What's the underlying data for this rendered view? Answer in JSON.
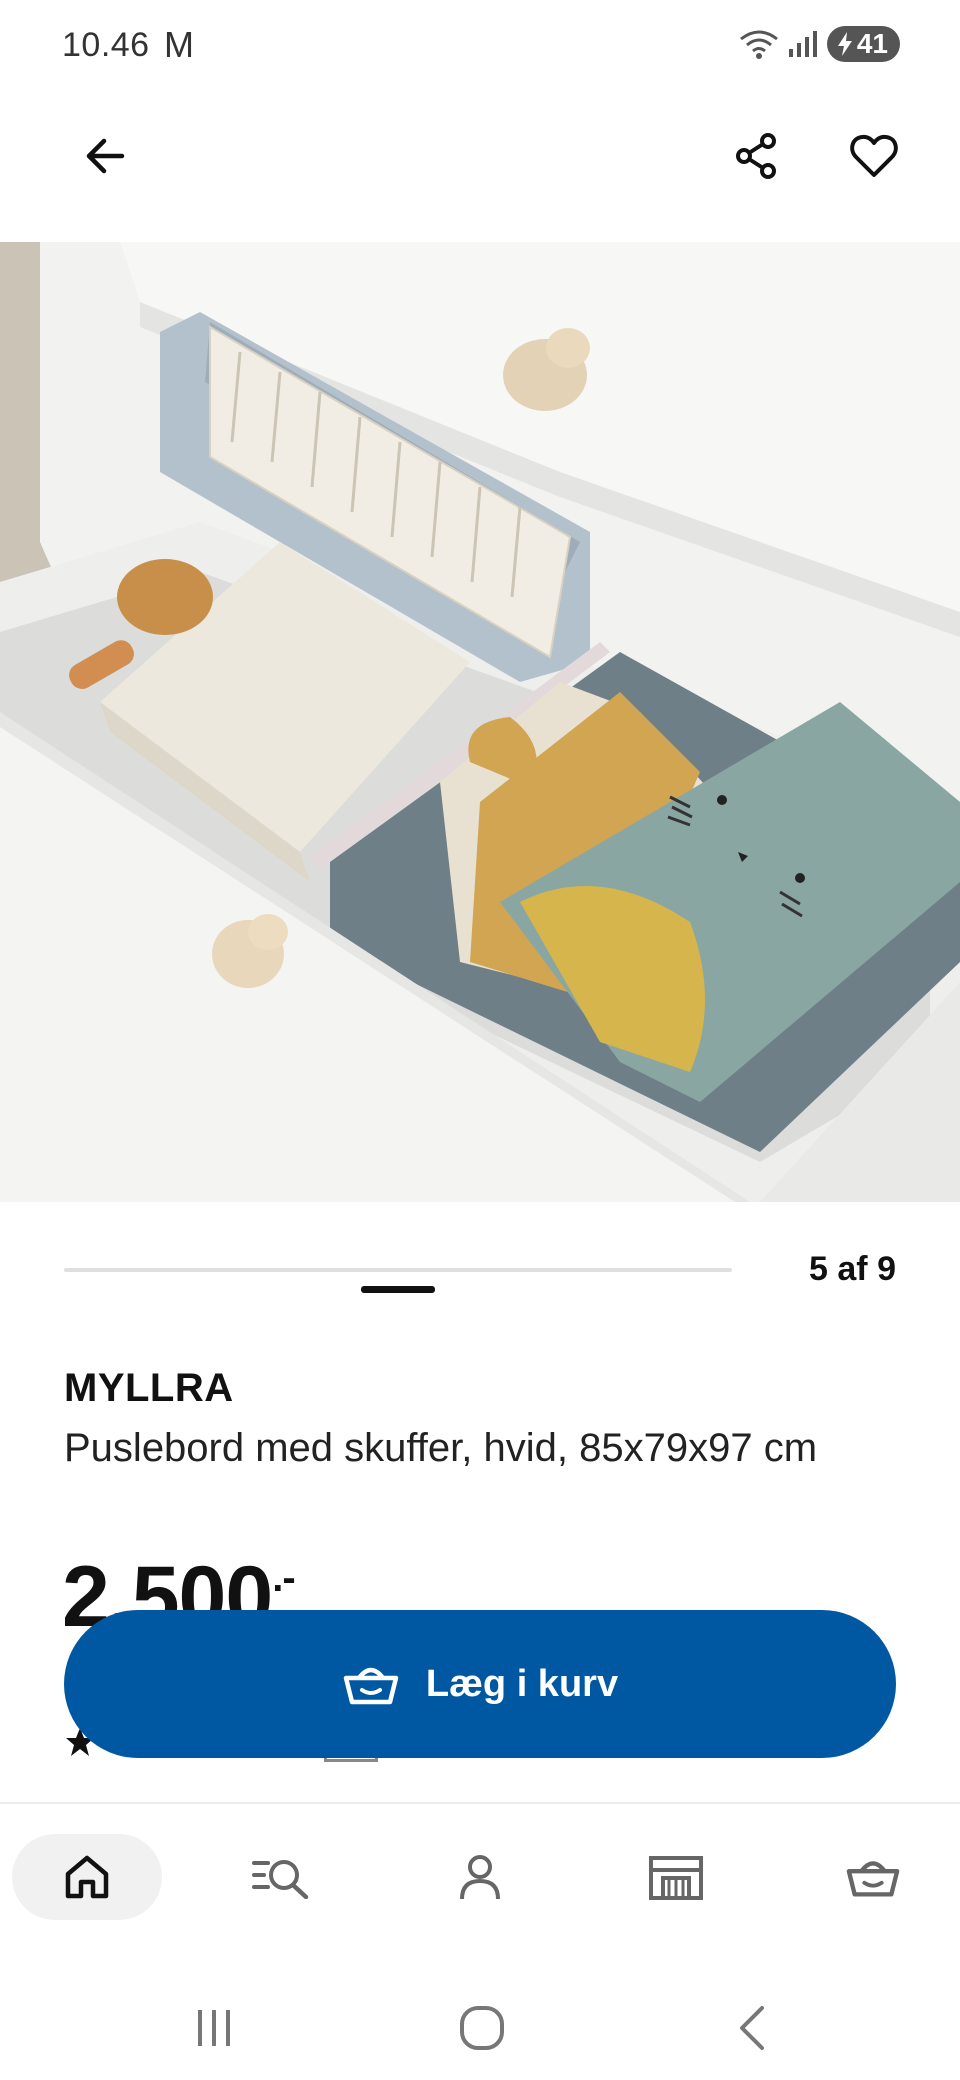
{
  "status_bar": {
    "time": "10.46",
    "app_glyph": "M",
    "battery_level": "41",
    "icons": [
      "wifi-icon",
      "signal-icon",
      "battery-charging-icon"
    ]
  },
  "app_bar": {
    "back_icon": "arrow-left-icon",
    "share_icon": "share-icon",
    "favorite_icon": "heart-icon"
  },
  "product_image": {
    "image_index": 5,
    "image_count": 9,
    "counter_label": "5 af 9"
  },
  "product": {
    "brand": "MYLLRA",
    "description": "Puslebord med skuffer, hvid, 85x79x97 cm",
    "price_main": "2.500",
    "price_suffix": ".-"
  },
  "cart_button": {
    "label": "Læg i kurv",
    "icon": "basket-icon"
  },
  "bottom_nav": {
    "items": [
      {
        "icon": "home-icon",
        "active": true
      },
      {
        "icon": "search-list-icon",
        "active": false
      },
      {
        "icon": "profile-icon",
        "active": false
      },
      {
        "icon": "store-icon",
        "active": false
      },
      {
        "icon": "basket-icon",
        "active": false
      }
    ]
  },
  "system_nav": {
    "items": [
      "recent-apps-icon",
      "home-circle-icon",
      "back-chevron-icon"
    ]
  },
  "colors": {
    "brand_blue": "#0058a3",
    "text": "#111111",
    "track": "#dfdfdf"
  }
}
